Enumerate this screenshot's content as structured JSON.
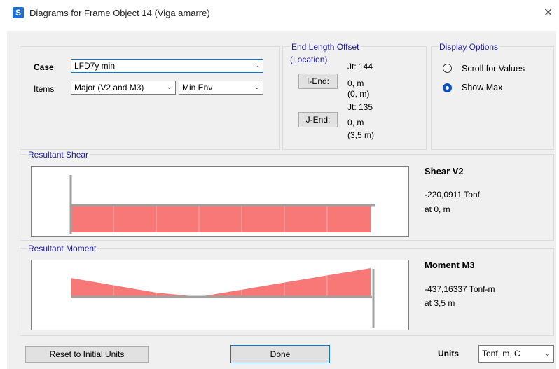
{
  "window": {
    "icon_letter": "S",
    "title": "Diagrams for Frame Object 14  (Viga amarre)",
    "close_glyph": "✕"
  },
  "case_group": {
    "case_label": "Case",
    "case_value": "LFD7y min",
    "items_label": "Items",
    "items_value": "Major (V2 and M3)",
    "env_value": "Min Env"
  },
  "end_length": {
    "title": "End Length Offset",
    "subtitle": "(Location)",
    "i_end_button": "I-End:",
    "i_jt": "Jt:  144",
    "i_offset": "0, m",
    "i_location": "(0, m)",
    "j_end_button": "J-End:",
    "j_jt": "Jt:  135",
    "j_offset": "0, m",
    "j_location": "(3,5 m)"
  },
  "display_options": {
    "title": "Display Options",
    "options": [
      {
        "label": "Scroll for Values",
        "checked": false
      },
      {
        "label": "Show Max",
        "checked": true
      }
    ]
  },
  "shear": {
    "title": "Resultant Shear",
    "result_title": "Shear V2",
    "value": "-220,0911 Tonf",
    "location": "at 0, m",
    "fill_color": "#f87878"
  },
  "moment": {
    "title": "Resultant Moment",
    "result_title": "Moment M3",
    "value": "-437,16337 Tonf-m",
    "location": "at 3,5 m",
    "fill_color": "#f87878"
  },
  "footer": {
    "reset_button": "Reset to Initial Units",
    "done_button": "Done",
    "units_label": "Units",
    "units_value": "Tonf, m, C"
  }
}
